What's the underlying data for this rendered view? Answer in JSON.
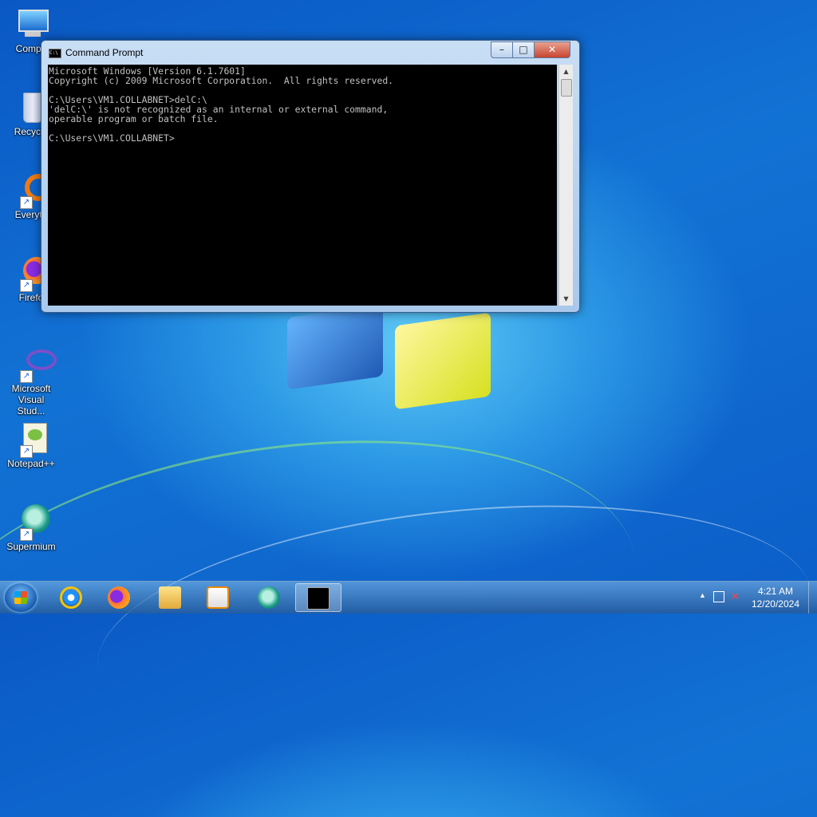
{
  "desktop": {
    "icons": [
      {
        "label": "Compu",
        "icon": "computer-icon"
      },
      {
        "label": "Recycle",
        "icon": "recycle-bin-icon"
      },
      {
        "label": "Everyth",
        "icon": "everything-icon"
      },
      {
        "label": "Firefo",
        "icon": "firefox-icon"
      },
      {
        "label": "Microsoft Visual Stud...",
        "icon": "visual-studio-icon"
      },
      {
        "label": "Notepad++",
        "icon": "notepad-plus-plus-icon"
      },
      {
        "label": "Supermium",
        "icon": "supermium-icon"
      }
    ]
  },
  "window": {
    "title": "Command Prompt",
    "minimize_glyph": "–",
    "maximize_glyph": "□",
    "close_glyph": "✕",
    "console_lines": [
      "Microsoft Windows [Version 6.1.7601]",
      "Copyright (c) 2009 Microsoft Corporation.  All rights reserved.",
      "",
      "C:\\Users\\VM1.COLLABNET>delC:\\",
      "'delC:\\' is not recognized as an internal or external command,",
      "operable program or batch file.",
      "",
      "C:\\Users\\VM1.COLLABNET>"
    ]
  },
  "taskbar": {
    "items": [
      {
        "name": "taskbar-ie",
        "icon": "internet-explorer-icon"
      },
      {
        "name": "taskbar-firefox",
        "icon": "firefox-icon"
      },
      {
        "name": "taskbar-explorer",
        "icon": "folder-icon"
      },
      {
        "name": "taskbar-media-player",
        "icon": "media-player-icon"
      },
      {
        "name": "taskbar-supermium",
        "icon": "supermium-icon"
      },
      {
        "name": "taskbar-cmd",
        "icon": "cmd-icon"
      }
    ],
    "clock_time": "4:21 AM",
    "clock_date": "12/20/2024"
  }
}
